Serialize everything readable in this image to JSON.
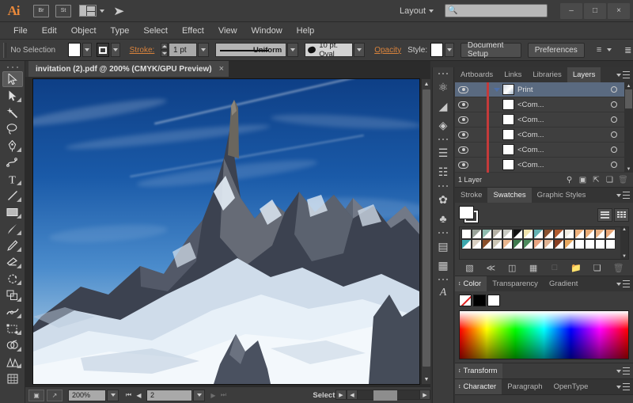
{
  "app": {
    "name": "Ai",
    "titlebar": {
      "bridge_icon": "Br",
      "stock_icon": "St",
      "arrange_label": "arrange-documents",
      "share_label": "share-on-behance",
      "workspace": "Layout",
      "search_placeholder": "",
      "search_value": "",
      "minimize": "–",
      "maximize": "□",
      "close": "×"
    }
  },
  "menubar": {
    "items": [
      "File",
      "Edit",
      "Object",
      "Type",
      "Select",
      "Effect",
      "View",
      "Window",
      "Help"
    ]
  },
  "controlbar": {
    "selection_status": "No Selection",
    "fill_color": "#ffffff",
    "stroke_label": "Stroke:",
    "stroke_weight": "1 pt",
    "profile_label": "Uniform",
    "brush_label": "10 pt. Oval",
    "opacity_label": "Opacity",
    "style_label": "Style:",
    "document_setup": "Document Setup",
    "preferences": "Preferences",
    "align_icon": "align-objects-icon",
    "panel_options_icon": "more-options-icon"
  },
  "document": {
    "tab_title": "invitation (2).pdf @ 200% (CMYK/GPU Preview)",
    "close_glyph": "×"
  },
  "toolbar": {
    "tools": [
      {
        "name": "selection-tool",
        "selected": true,
        "has_flyout": false
      },
      {
        "name": "direct-selection-tool",
        "selected": false,
        "has_flyout": true
      },
      {
        "name": "magic-wand-tool",
        "selected": false,
        "has_flyout": false
      },
      {
        "name": "lasso-tool",
        "selected": false,
        "has_flyout": false
      },
      {
        "name": "pen-tool",
        "selected": false,
        "has_flyout": true
      },
      {
        "name": "curvature-tool",
        "selected": false,
        "has_flyout": false
      },
      {
        "name": "type-tool",
        "selected": false,
        "has_flyout": true
      },
      {
        "name": "line-segment-tool",
        "selected": false,
        "has_flyout": true
      },
      {
        "name": "rectangle-tool",
        "selected": false,
        "has_flyout": true
      },
      {
        "name": "paintbrush-tool",
        "selected": false,
        "has_flyout": true
      },
      {
        "name": "pencil-tool",
        "selected": false,
        "has_flyout": true
      },
      {
        "name": "eraser-tool",
        "selected": false,
        "has_flyout": true
      },
      {
        "name": "rotate-tool",
        "selected": false,
        "has_flyout": true
      },
      {
        "name": "scale-tool",
        "selected": false,
        "has_flyout": true
      },
      {
        "name": "width-tool",
        "selected": false,
        "has_flyout": true
      },
      {
        "name": "free-transform-tool",
        "selected": false,
        "has_flyout": false
      },
      {
        "name": "shape-builder-tool",
        "selected": false,
        "has_flyout": true
      },
      {
        "name": "perspective-grid-tool",
        "selected": false,
        "has_flyout": true
      },
      {
        "name": "mesh-tool",
        "selected": false,
        "has_flyout": false
      }
    ]
  },
  "canvas": {
    "artwork_description": "snow-covered alpine mountain peak under deep blue sky",
    "zoom": "200%"
  },
  "statusbar": {
    "artboard_icon": "artboard-navigation-icon",
    "export_icon": "share-document-icon",
    "zoom_value": "200%",
    "artboard_number": "2",
    "first_glyph": "⏮",
    "prev_glyph": "◀",
    "next_glyph": "▶",
    "last_glyph": "⏭",
    "status_text": "Selection"
  },
  "icondock": {
    "groups": [
      [
        "brushes-icon",
        "gradient-icon",
        "pathfinder-icon"
      ],
      [
        "align-icon",
        "transform-panel-icon"
      ],
      [
        "symbols-icon",
        "pattern-icon"
      ],
      [
        "appearance-icon",
        "graphic-styles-icon"
      ],
      [
        "glyphs-icon"
      ]
    ]
  },
  "panels": {
    "layers": {
      "tabs": [
        {
          "label": "Artboards",
          "active": false
        },
        {
          "label": "Links",
          "active": false
        },
        {
          "label": "Libraries",
          "active": false
        },
        {
          "label": "Layers",
          "active": true
        }
      ],
      "rows": [
        {
          "name": "Print",
          "selected": true,
          "is_parent": true,
          "visible": true,
          "locked": false
        },
        {
          "name": "<Com...",
          "selected": false,
          "is_parent": false,
          "visible": true,
          "locked": false
        },
        {
          "name": "<Com...",
          "selected": false,
          "is_parent": false,
          "visible": true,
          "locked": false
        },
        {
          "name": "<Com...",
          "selected": false,
          "is_parent": false,
          "visible": true,
          "locked": false
        },
        {
          "name": "<Com...",
          "selected": false,
          "is_parent": false,
          "visible": true,
          "locked": false
        },
        {
          "name": "<Com...",
          "selected": false,
          "is_parent": false,
          "visible": true,
          "locked": false
        }
      ],
      "footer_count": "1 Layer",
      "footer_icons": [
        "locate-object-icon",
        "make-clipping-mask-icon",
        "create-new-sublayer-icon",
        "create-new-layer-icon",
        "delete-selection-icon"
      ]
    },
    "swatches": {
      "tabs": [
        {
          "label": "Stroke",
          "active": false
        },
        {
          "label": "Swatches",
          "active": true
        },
        {
          "label": "Graphic Styles",
          "active": false
        }
      ],
      "fill_color": "#ffffff",
      "stroke_color": "#ffffff",
      "view_list_icon": "list-view-icon",
      "view_grid_icon": "grid-view-icon",
      "colors": [
        "#ffffff",
        "#9aa39a",
        "#8fbdb0",
        "#b6b2a6",
        "#c9cbc4",
        "#121212",
        "#efe3ae",
        "#63b2b3",
        "#8a5230",
        "#b15b2e",
        "#f0ece2",
        "#eeb17c",
        "#e8ab76",
        "#e9b183",
        "#e7a677",
        "#3aa8ae",
        "#d9cfc2",
        "#8a4f2a",
        "#cdc7b6",
        "#e9b68e",
        "#3e7a4d",
        "#4c8b5c",
        "#e9a582",
        "#e0b292",
        "#8a3f22",
        "#e8a860",
        "#ffffff",
        "#ffffff",
        "#ffffff",
        "#ffffff"
      ],
      "footer_icons": [
        "swatch-libraries-icon",
        "color-theme-icon",
        "library-link-icon",
        "show-kind-icon",
        "swatch-options-icon",
        "new-color-group-icon",
        "new-swatch-icon",
        "delete-swatch-icon"
      ]
    },
    "color": {
      "tabs": [
        {
          "label": "Color",
          "active": true
        },
        {
          "label": "Transparency",
          "active": false
        },
        {
          "label": "Gradient",
          "active": false
        }
      ],
      "none_swatch": "none",
      "black_swatch": "#000000",
      "white_swatch": "#ffffff",
      "spectrum_label": "cmyk-color-spectrum"
    },
    "transform": {
      "title": "Transform"
    },
    "character": {
      "tabs": [
        {
          "label": "Character",
          "active": true
        },
        {
          "label": "Paragraph",
          "active": false
        },
        {
          "label": "OpenType",
          "active": false
        }
      ]
    }
  }
}
